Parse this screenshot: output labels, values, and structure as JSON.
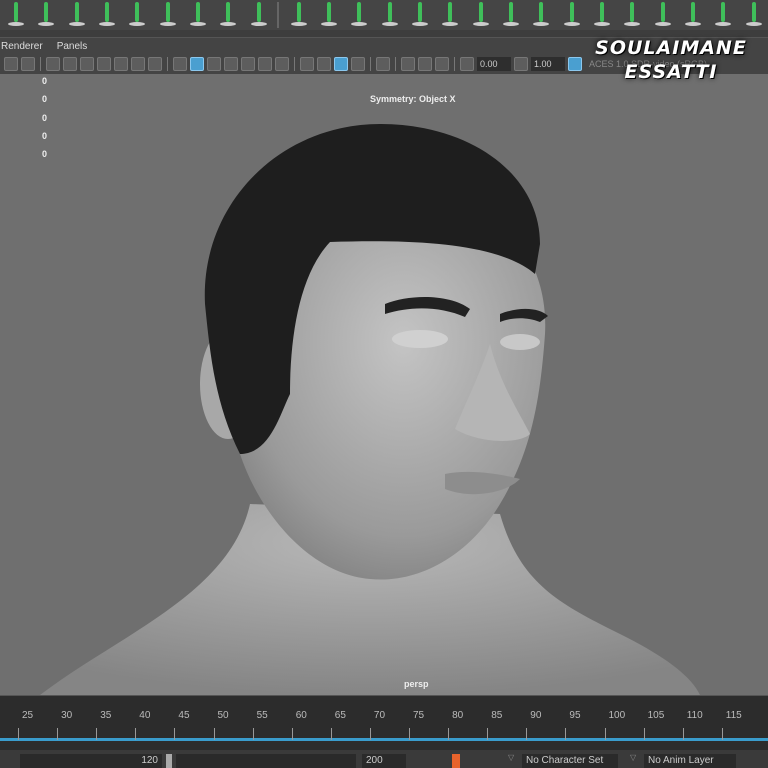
{
  "menu": {
    "items": [
      "Renderer",
      "Panels"
    ]
  },
  "toolbar": {
    "exposure": "0.00",
    "gamma": "1.00",
    "color_space": "ACES 1.0 SDR-video (sRGB)"
  },
  "viewport": {
    "hud_values": [
      "0",
      "0",
      "0",
      "0",
      "0"
    ],
    "symmetry": "Symmetry: Object X",
    "camera": "persp",
    "watermark": [
      "SOULAIMANE",
      "ESSATTI"
    ]
  },
  "timeline": {
    "ticks": [
      "25",
      "30",
      "35",
      "40",
      "45",
      "50",
      "55",
      "60",
      "65",
      "70",
      "75",
      "80",
      "85",
      "90",
      "95",
      "100",
      "105",
      "110",
      "115"
    ]
  },
  "range": {
    "end": "120",
    "anim_end": "200",
    "character_set": "No Character Set",
    "anim_layer": "No Anim Layer"
  },
  "colors": {
    "accent": "#3a9ccc",
    "shelf_green": "#3fbf5a",
    "key": "#e8632c"
  }
}
